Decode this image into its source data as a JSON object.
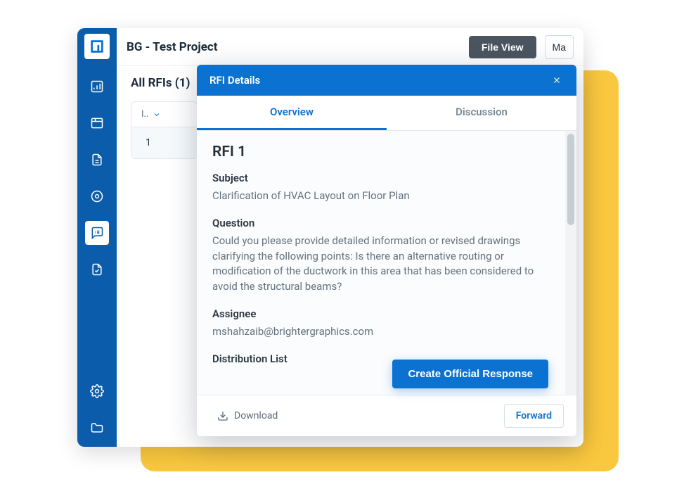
{
  "sidebar": {
    "items": [
      {
        "name": "dashboard"
      },
      {
        "name": "plans"
      },
      {
        "name": "documents"
      },
      {
        "name": "photos"
      },
      {
        "name": "rfi",
        "active": true
      },
      {
        "name": "checklists"
      }
    ],
    "bottom": [
      {
        "name": "settings"
      },
      {
        "name": "folder"
      }
    ]
  },
  "topbar": {
    "title": "BG - Test Project",
    "file_view": "File View",
    "ma": "Ma"
  },
  "content": {
    "section_title": "All RFIs (1)",
    "table": {
      "header": "I..",
      "rows": [
        "1"
      ]
    }
  },
  "modal": {
    "title": "RFI Details",
    "tabs": {
      "overview": "Overview",
      "discussion": "Discussion"
    },
    "rfi_title": "RFI 1",
    "subject": {
      "label": "Subject",
      "value": "Clarification of HVAC Layout on Floor Plan"
    },
    "question": {
      "label": "Question",
      "value": "Could you please provide detailed information or revised drawings clarifying the following points: Is there an alternative routing or modification of the ductwork in this area that has been considered to avoid the structural beams?"
    },
    "assignee": {
      "label": "Assignee",
      "value": "mshahzaib@brightergraphics.com"
    },
    "distribution": {
      "label": "Distribution List"
    },
    "create_response": "Create Official Response",
    "footer": {
      "download": "Download",
      "forward": "Forward"
    }
  }
}
